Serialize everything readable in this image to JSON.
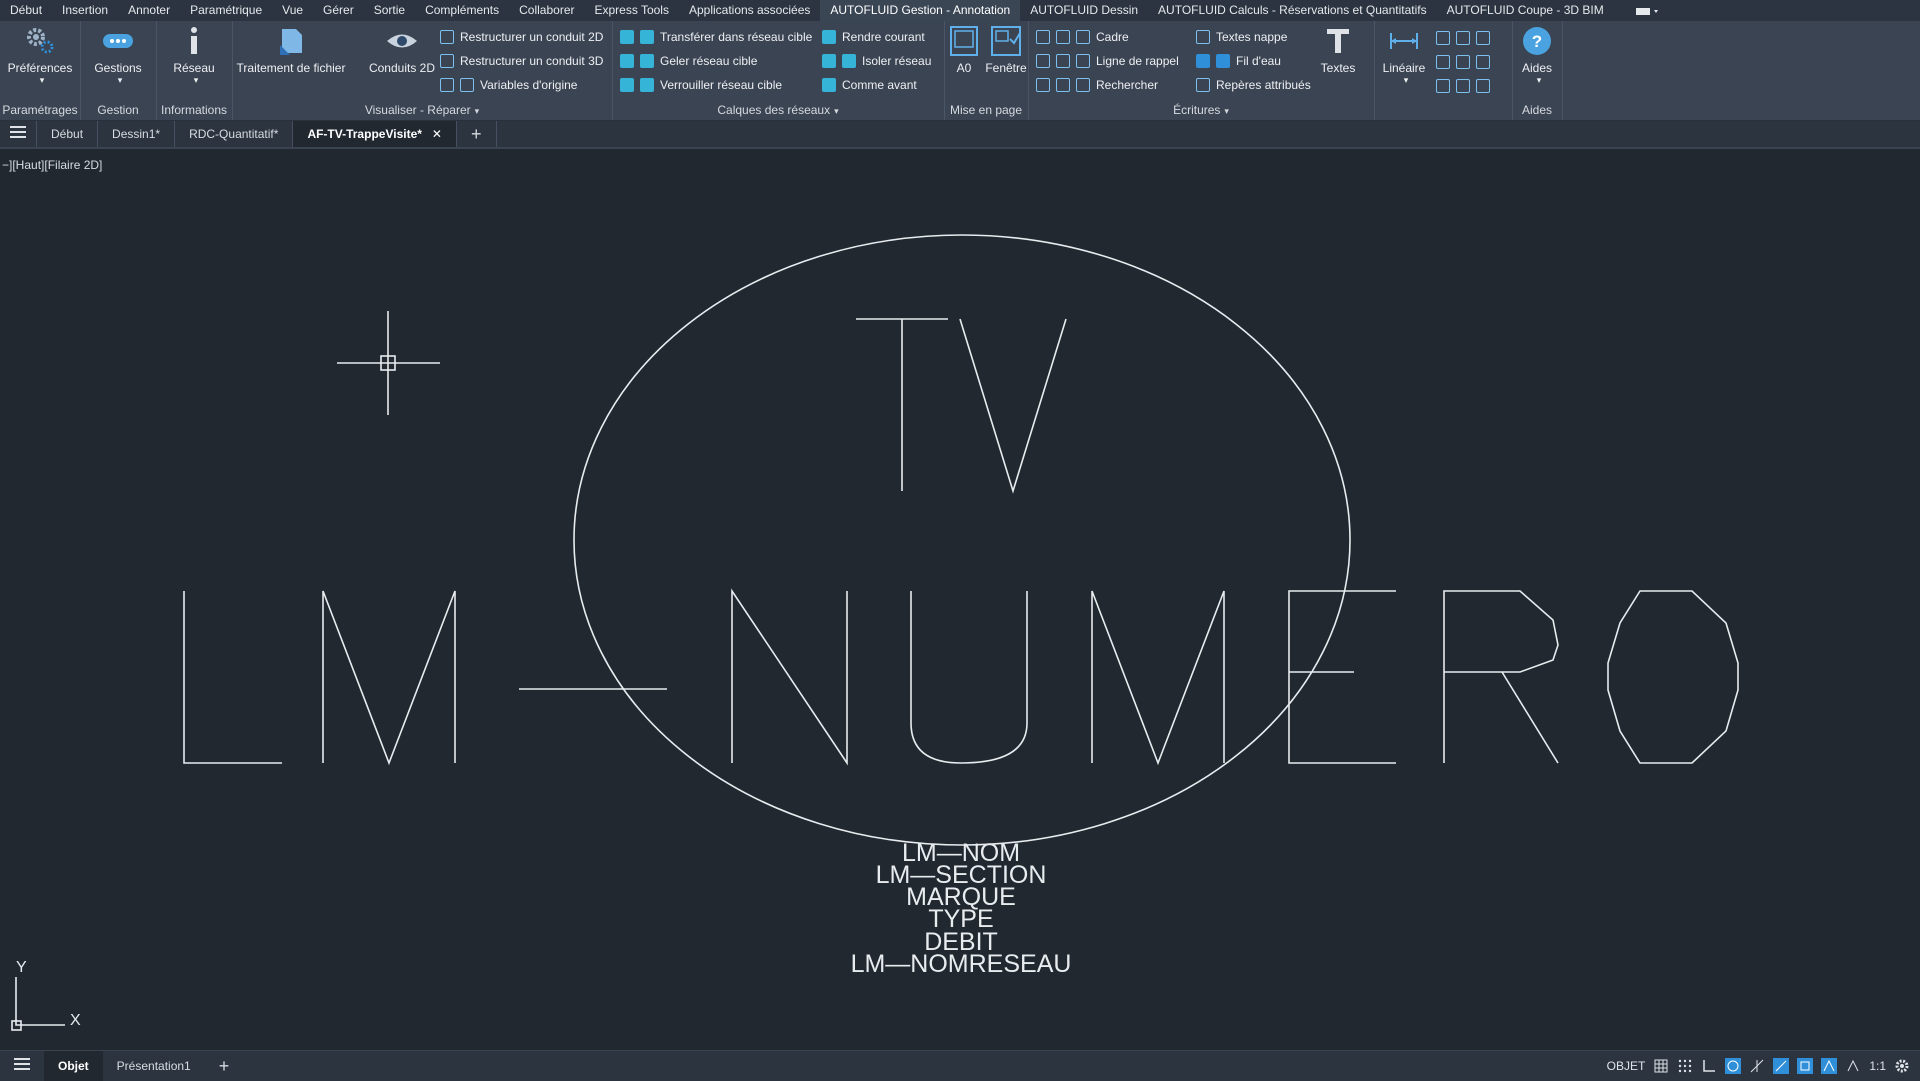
{
  "menu": {
    "tabs": [
      "Début",
      "Insertion",
      "Annoter",
      "Paramétrique",
      "Vue",
      "Gérer",
      "Sortie",
      "Compléments",
      "Collaborer",
      "Express Tools",
      "Applications associées",
      "AUTOFLUID Gestion - Annotation",
      "AUTOFLUID Dessin",
      "AUTOFLUID Calculs - Réservations et Quantitatifs",
      "AUTOFLUID Coupe - 3D BIM"
    ],
    "active_tab": "AUTOFLUID Gestion - Annotation"
  },
  "ribbon": {
    "preferences": {
      "label": "Préférences",
      "panel": "Paramétrages"
    },
    "gestions": {
      "label": "Gestions",
      "panel": "Gestion"
    },
    "reseau": {
      "label": "Réseau",
      "panel": "Informations"
    },
    "traitement": {
      "label": "Traitement de fichier"
    },
    "conduits2d": {
      "label": "Conduits 2D"
    },
    "restructurer2d": "Restructurer un conduit 2D",
    "restructurer3d": "Restructurer un conduit 3D",
    "variables": "Variables d'origine",
    "visualiser_panel": "Visualiser - Réparer",
    "transferer": "Transférer dans réseau cible",
    "geler": "Geler réseau cible",
    "verrouiller": "Verrouiller réseau cible",
    "rendre_courant": "Rendre courant",
    "isoler": "Isoler réseau",
    "comme_avant": "Comme avant",
    "calques_panel": "Calques des réseaux",
    "a0": "A0",
    "fenetre": "Fenêtre",
    "mise_en_page_panel": "Mise en page",
    "cadre": "Cadre",
    "ligne_rappel": "Ligne de rappel",
    "rechercher": "Rechercher",
    "textes_nappe": "Textes nappe",
    "fil_eau": "Fil d'eau",
    "reperes": "Repères attribués",
    "textes": "Textes",
    "ecritures_panel": "Écritures",
    "lineaire": "Linéaire",
    "aides": "Aides",
    "aides_panel": "Aides"
  },
  "doc_tabs": [
    "Début",
    "Dessin1*",
    "RDC-Quantitatif*",
    "AF-TV-TrappeVisite*"
  ],
  "active_doc": "AF-TV-TrappeVisite*",
  "view_label": "−][Haut][Filaire 2D]",
  "drawing": {
    "top_text": "TV",
    "main_text": "LM—NUMERO",
    "attributes": [
      "LM—NOM",
      "LM—SECTION",
      "MARQUE",
      "TYPE",
      "DEBIT",
      "LM—NOMRESEAU"
    ],
    "ucs_y": "Y",
    "ucs_x": "X"
  },
  "layout_tabs": [
    "Objet",
    "Présentation1"
  ],
  "status": {
    "objet": "OBJET",
    "scale": "1:1"
  },
  "colors": {
    "background": "#212830",
    "line": "#e8ecef",
    "accent": "#2f8fd8"
  }
}
